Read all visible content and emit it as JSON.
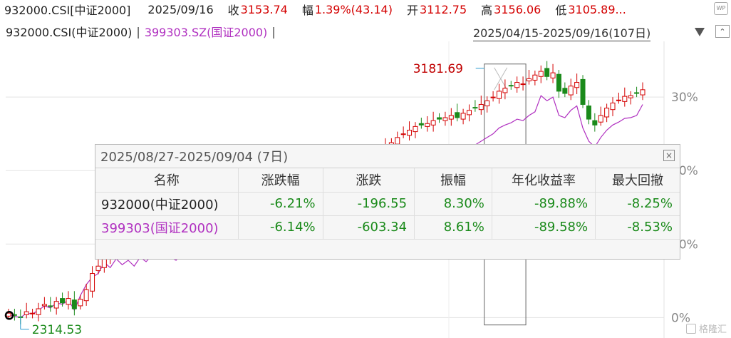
{
  "header": {
    "symbol": "932000.CSI[中证2000]",
    "date": "2025/09/16",
    "close_label": "收",
    "close_value": "3153.74",
    "change_label": "幅",
    "change_value": "1.39%(43.14)",
    "open_label": "开",
    "open_value": "3112.75",
    "high_label": "高",
    "high_value": "3156.06",
    "low_label": "低",
    "low_value": "3105.89...",
    "logo_text": "WP"
  },
  "legend": {
    "series1": "932000.CSI(中证2000)",
    "separator": "|",
    "series2": "399303.SZ(国证2000)",
    "separator2": "|",
    "range": "2025/04/15-2025/09/16(107日)",
    "collapse": "⌃"
  },
  "popup": {
    "title": "2025/08/27-2025/09/04 (7日)",
    "close": "×",
    "headers": [
      "名称",
      "涨跌幅",
      "涨跌",
      "振幅",
      "年化收益率",
      "最大回撤"
    ],
    "rows": [
      {
        "name": "932000(中证2000)",
        "values": [
          "-6.21%",
          "-196.55",
          "8.30%",
          "-89.88%",
          "-8.25%"
        ]
      },
      {
        "name": "399303(国证2000)",
        "values": [
          "-6.14%",
          "-603.34",
          "8.61%",
          "-89.58%",
          "-8.53%"
        ]
      }
    ]
  },
  "watermark": "格隆汇",
  "chart_data": {
    "type": "line",
    "ylabel": "",
    "y_ticks": [
      "30%",
      "20%",
      "10%",
      "0%"
    ],
    "y_range": [
      -0.02,
      0.37
    ],
    "annotations": [
      {
        "text": "3181.69",
        "label": "high"
      },
      {
        "text": "2314.53",
        "label": "low"
      }
    ],
    "series": [
      {
        "name": "932000.CSI(中证2000)",
        "kind": "candlestick",
        "color_up": "#d40000",
        "color_down": "#1a8a1a",
        "values": [
          0.006,
          0.003,
          0.0,
          0.008,
          0.006,
          0.012,
          0.018,
          0.015,
          0.022,
          0.02,
          0.026,
          0.012,
          0.025,
          0.038,
          0.06,
          0.07,
          0.084,
          0.089,
          0.098,
          0.105,
          0.112,
          0.108,
          0.115,
          0.11,
          0.118,
          0.125,
          0.128,
          0.122,
          0.13,
          0.134,
          0.128,
          0.138,
          0.142,
          0.135,
          0.14,
          0.138,
          0.145,
          0.15,
          0.148,
          0.152,
          0.155,
          0.15,
          0.158,
          0.162,
          0.16,
          0.165,
          0.158,
          0.168,
          0.172,
          0.175,
          0.17,
          0.178,
          0.182,
          0.186,
          0.18,
          0.185,
          0.19,
          0.195,
          0.2,
          0.205,
          0.212,
          0.218,
          0.225,
          0.232,
          0.238,
          0.245,
          0.25,
          0.255,
          0.26,
          0.262,
          0.264,
          0.268,
          0.27,
          0.272,
          0.275,
          0.272,
          0.278,
          0.282,
          0.285,
          0.29,
          0.295,
          0.3,
          0.308,
          0.312,
          0.315,
          0.32,
          0.318,
          0.325,
          0.33,
          0.335,
          0.328,
          0.333,
          0.308,
          0.305,
          0.315,
          0.32,
          0.29,
          0.27,
          0.262,
          0.275,
          0.285,
          0.292,
          0.296,
          0.301,
          0.302,
          0.305,
          0.31
        ]
      },
      {
        "name": "399303.SZ(国证2000)",
        "kind": "line",
        "color": "#b030c0",
        "values": [
          0.004,
          0.002,
          0.0,
          0.006,
          0.005,
          0.01,
          0.016,
          0.013,
          0.02,
          0.018,
          0.024,
          0.01,
          0.03,
          0.045,
          0.055,
          0.06,
          0.075,
          0.068,
          0.08,
          0.072,
          0.078,
          0.07,
          0.082,
          0.076,
          0.085,
          0.08,
          0.088,
          0.082,
          0.078,
          0.086,
          0.09,
          0.084,
          0.092,
          0.088,
          0.094,
          0.09,
          0.096,
          0.1,
          0.098,
          0.104,
          0.108,
          0.102,
          0.11,
          0.114,
          0.112,
          0.118,
          0.11,
          0.12,
          0.124,
          0.128,
          0.122,
          0.13,
          0.134,
          0.138,
          0.132,
          0.137,
          0.142,
          0.147,
          0.152,
          0.156,
          0.162,
          0.168,
          0.175,
          0.182,
          0.188,
          0.195,
          0.2,
          0.205,
          0.21,
          0.212,
          0.214,
          0.218,
          0.22,
          0.222,
          0.225,
          0.222,
          0.228,
          0.232,
          0.235,
          0.24,
          0.245,
          0.25,
          0.258,
          0.262,
          0.265,
          0.27,
          0.268,
          0.275,
          0.28,
          0.302,
          0.295,
          0.3,
          0.275,
          0.272,
          0.282,
          0.288,
          0.258,
          0.24,
          0.232,
          0.245,
          0.255,
          0.262,
          0.266,
          0.271,
          0.272,
          0.275,
          0.29
        ]
      }
    ],
    "highlight_range": [
      80,
      86
    ]
  }
}
